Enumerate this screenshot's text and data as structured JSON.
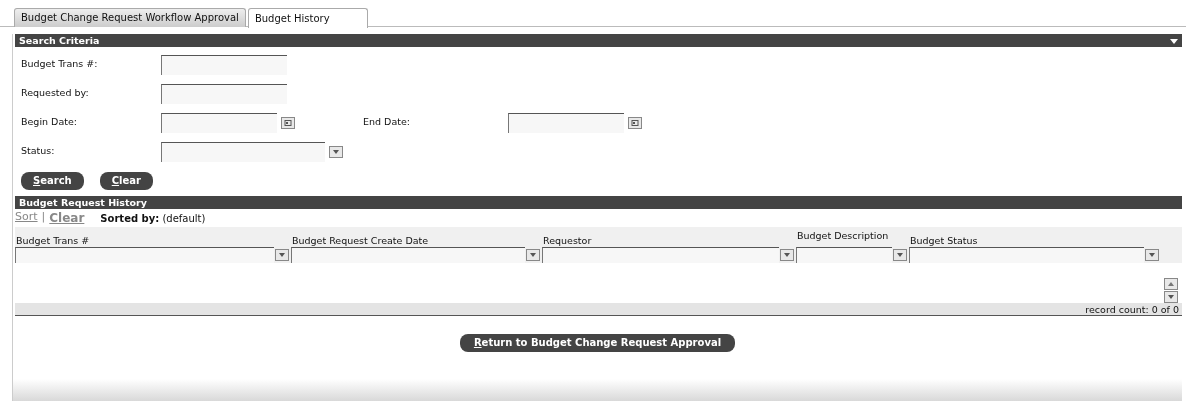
{
  "tabs": [
    {
      "label": "Budget Change Request Workflow Approval",
      "selected": false
    },
    {
      "label": "Budget History",
      "selected": true
    }
  ],
  "search_criteria": {
    "title": "Search Criteria",
    "rows": [
      [
        {
          "label": "Budget Trans #:",
          "kind": "text"
        }
      ],
      [
        {
          "label": "Requested by:",
          "kind": "text"
        }
      ],
      [
        {
          "label": "Begin Date:",
          "kind": "date"
        },
        {
          "label": "End Date:",
          "kind": "date"
        }
      ],
      [
        {
          "label": "Status:",
          "kind": "select"
        }
      ]
    ],
    "buttons": [
      {
        "label": "Search",
        "underline_first": true
      },
      {
        "label": "Clear",
        "underline_first": true
      }
    ]
  },
  "history": {
    "title": "Budget Request History",
    "sort_link": "Sort",
    "separator": "|",
    "clear_link": "Clear",
    "sorted_by_label": "Sorted by:",
    "sorted_by_value": "(default)",
    "columns": [
      {
        "title": "Budget Trans #"
      },
      {
        "title": "Budget Request Create Date"
      },
      {
        "title": "Requestor"
      },
      {
        "title": "Budget Description"
      },
      {
        "title": "Budget Status"
      }
    ],
    "record_count": "record count: 0 of 0"
  },
  "return_button": {
    "label": "Return to Budget Change Request Approval",
    "underline_first": true
  }
}
